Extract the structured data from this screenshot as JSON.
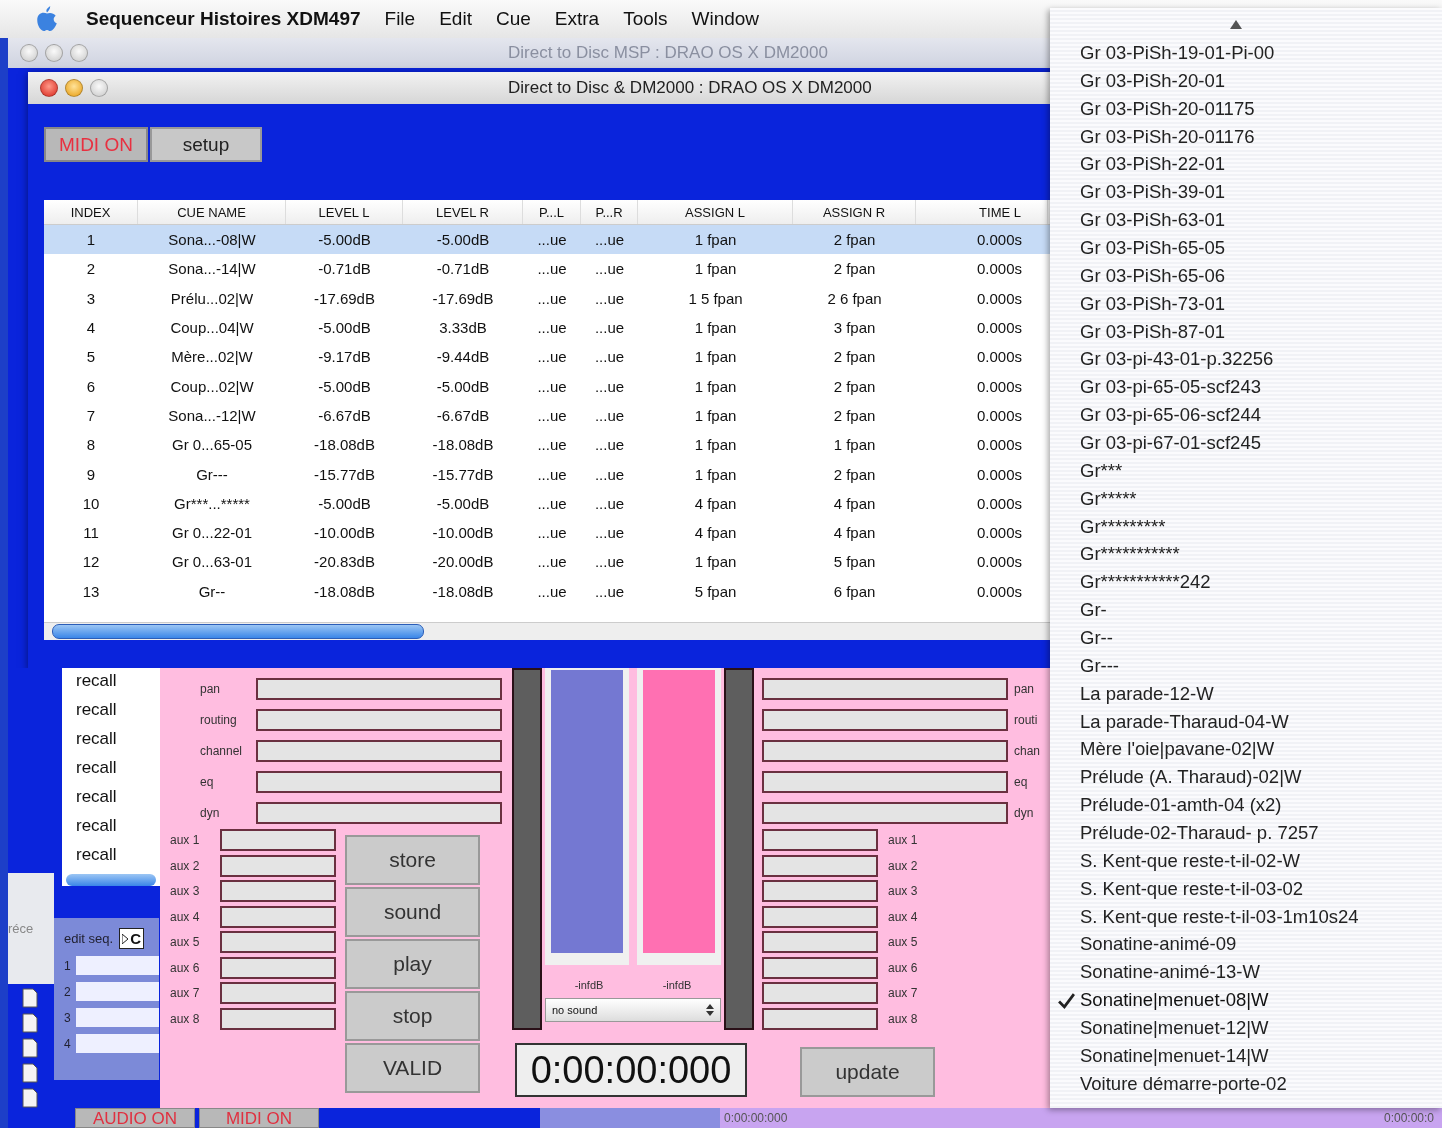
{
  "menu_bar": {
    "app_name": "Sequenceur Histoires XDM497",
    "menus": [
      "File",
      "Edit",
      "Cue",
      "Extra",
      "Tools",
      "Window"
    ]
  },
  "back_window": {
    "title": "Direct to Disc MSP : DRAO OS X DM2000"
  },
  "main_window": {
    "title": "Direct to Disc & DM2000 : DRAO OS X DM2000",
    "buttons": [
      {
        "label": "MIDI ON",
        "on": true
      },
      {
        "label": "setup",
        "on": false
      }
    ]
  },
  "table": {
    "columns": [
      "INDEX",
      "CUE NAME",
      "LEVEL L",
      "LEVEL R",
      "P...L",
      "P...R",
      "ASSIGN L",
      "ASSIGN R",
      "TIME L"
    ],
    "rows": [
      {
        "selected": true,
        "cells": [
          "1",
          "Sona...-08|W",
          "-5.00dB",
          "-5.00dB",
          "...ue",
          "...ue",
          "1 fpan",
          "2 fpan",
          "0.000s"
        ]
      },
      {
        "selected": false,
        "cells": [
          "2",
          "Sona...-14|W",
          "-0.71dB",
          "-0.71dB",
          "...ue",
          "...ue",
          "1 fpan",
          "2 fpan",
          "0.000s"
        ]
      },
      {
        "selected": false,
        "cells": [
          "3",
          "Prélu...02|W",
          "-17.69dB",
          "-17.69dB",
          "...ue",
          "...ue",
          "1 5 fpan",
          "2 6 fpan",
          "0.000s"
        ]
      },
      {
        "selected": false,
        "cells": [
          "4",
          "Coup...04|W",
          "-5.00dB",
          "3.33dB",
          "...ue",
          "...ue",
          "1 fpan",
          "3 fpan",
          "0.000s"
        ]
      },
      {
        "selected": false,
        "cells": [
          "5",
          "Mère...02|W",
          "-9.17dB",
          "-9.44dB",
          "...ue",
          "...ue",
          "1 fpan",
          "2 fpan",
          "0.000s"
        ]
      },
      {
        "selected": false,
        "cells": [
          "6",
          "Coup...02|W",
          "-5.00dB",
          "-5.00dB",
          "...ue",
          "...ue",
          "1 fpan",
          "2 fpan",
          "0.000s"
        ]
      },
      {
        "selected": false,
        "cells": [
          "7",
          "Sona...-12|W",
          "-6.67dB",
          "-6.67dB",
          "...ue",
          "...ue",
          "1 fpan",
          "2 fpan",
          "0.000s"
        ]
      },
      {
        "selected": false,
        "cells": [
          "8",
          "Gr 0...65-05",
          "-18.08dB",
          "-18.08dB",
          "...ue",
          "...ue",
          "1 fpan",
          "1 fpan",
          "0.000s"
        ]
      },
      {
        "selected": false,
        "cells": [
          "9",
          "Gr---",
          "-15.77dB",
          "-15.77dB",
          "...ue",
          "...ue",
          "1 fpan",
          "2 fpan",
          "0.000s"
        ]
      },
      {
        "selected": false,
        "cells": [
          "10",
          "Gr***...*****",
          "-5.00dB",
          "-5.00dB",
          "...ue",
          "...ue",
          "4 fpan",
          "4 fpan",
          "0.000s"
        ]
      },
      {
        "selected": false,
        "cells": [
          "11",
          "Gr 0...22-01",
          "-10.00dB",
          "-10.00dB",
          "...ue",
          "...ue",
          "4 fpan",
          "4 fpan",
          "0.000s"
        ]
      },
      {
        "selected": false,
        "cells": [
          "12",
          "Gr 0...63-01",
          "-20.83dB",
          "-20.00dB",
          "...ue",
          "...ue",
          "1 fpan",
          "5 fpan",
          "0.000s"
        ]
      },
      {
        "selected": false,
        "cells": [
          "13",
          "Gr--",
          "-18.08dB",
          "-18.08dB",
          "...ue",
          "...ue",
          "5 fpan",
          "6 fpan",
          "0.000s"
        ]
      }
    ]
  },
  "recall_list": [
    "recall",
    "recall",
    "recall",
    "recall",
    "recall",
    "recall",
    "recall"
  ],
  "background_label": "réce",
  "edit_seq": {
    "label": "edit seq.",
    "selector": "C",
    "rows": [
      "1",
      "2",
      "3",
      "4"
    ]
  },
  "channel_panel": {
    "left_fields": [
      "pan",
      "routing",
      "channel",
      "eq",
      "dyn"
    ],
    "left_aux": [
      "aux 1",
      "aux 2",
      "aux 3",
      "aux 4",
      "aux 5",
      "aux 6",
      "aux 7",
      "aux 8"
    ],
    "actions": [
      "store",
      "sound",
      "play",
      "stop",
      "VALID"
    ],
    "meters": [
      {
        "reading": "-infdB",
        "level": 1,
        "color": "#7478d2"
      },
      {
        "reading": "-infdB",
        "level": 1,
        "color": "#ff70b2"
      }
    ],
    "sound_select": "no sound",
    "timecode": "0:00:00:000",
    "update_button": "update",
    "right_fields": [
      "pan",
      "routi",
      "chan",
      "eq",
      "dyn"
    ],
    "right_aux": [
      "aux 1",
      "aux 2",
      "aux 3",
      "aux 4",
      "aux 5",
      "aux 6",
      "aux 7",
      "aux 8"
    ]
  },
  "bottom_bar": {
    "buttons": [
      {
        "label": "AUDIO ON",
        "on": true
      },
      {
        "label": "MIDI ON",
        "on": true
      }
    ],
    "timecode": "0:00:00:000",
    "right_timecode": "0:00:00:0"
  },
  "popup_menu": {
    "items": [
      {
        "label": "Gr 03-PiSh-19-01-Pi-00",
        "checked": false
      },
      {
        "label": "Gr 03-PiSh-20-01",
        "checked": false
      },
      {
        "label": "Gr 03-PiSh-20-01175",
        "checked": false
      },
      {
        "label": "Gr 03-PiSh-20-01176",
        "checked": false
      },
      {
        "label": "Gr 03-PiSh-22-01",
        "checked": false
      },
      {
        "label": "Gr 03-PiSh-39-01",
        "checked": false
      },
      {
        "label": "Gr 03-PiSh-63-01",
        "checked": false
      },
      {
        "label": "Gr 03-PiSh-65-05",
        "checked": false
      },
      {
        "label": "Gr 03-PiSh-65-06",
        "checked": false
      },
      {
        "label": "Gr 03-PiSh-73-01",
        "checked": false
      },
      {
        "label": "Gr 03-PiSh-87-01",
        "checked": false
      },
      {
        "label": "Gr 03-pi-43-01-p.32256",
        "checked": false
      },
      {
        "label": "Gr 03-pi-65-05-scf243",
        "checked": false
      },
      {
        "label": "Gr 03-pi-65-06-scf244",
        "checked": false
      },
      {
        "label": "Gr 03-pi-67-01-scf245",
        "checked": false
      },
      {
        "label": "Gr***",
        "checked": false
      },
      {
        "label": "Gr*****",
        "checked": false
      },
      {
        "label": "Gr*********",
        "checked": false
      },
      {
        "label": "Gr***********",
        "checked": false
      },
      {
        "label": "Gr***********242",
        "checked": false
      },
      {
        "label": "Gr-",
        "checked": false
      },
      {
        "label": "Gr--",
        "checked": false
      },
      {
        "label": "Gr---",
        "checked": false
      },
      {
        "label": "La parade-12-W",
        "checked": false
      },
      {
        "label": "La parade-Tharaud-04-W",
        "checked": false
      },
      {
        "label": "Mère l'oie|pavane-02|W",
        "checked": false
      },
      {
        "label": "Prélude (A. Tharaud)-02|W",
        "checked": false
      },
      {
        "label": "Prélude-01-amth-04 (x2)",
        "checked": false
      },
      {
        "label": "Prélude-02-Tharaud- p. 7257",
        "checked": false
      },
      {
        "label": "S. Kent-que reste-t-il-02-W",
        "checked": false
      },
      {
        "label": "S. Kent-que reste-t-il-03-02",
        "checked": false
      },
      {
        "label": "S. Kent-que reste-t-il-03-1m10s24",
        "checked": false
      },
      {
        "label": "Sonatine-animé-09",
        "checked": false
      },
      {
        "label": "Sonatine-animé-13-W",
        "checked": false
      },
      {
        "label": "Sonatine|menuet-08|W",
        "checked": true
      },
      {
        "label": "Sonatine|menuet-12|W",
        "checked": false
      },
      {
        "label": "Sonatine|menuet-14|W",
        "checked": false
      },
      {
        "label": "Voiture démarre-porte-02",
        "checked": false
      }
    ]
  }
}
